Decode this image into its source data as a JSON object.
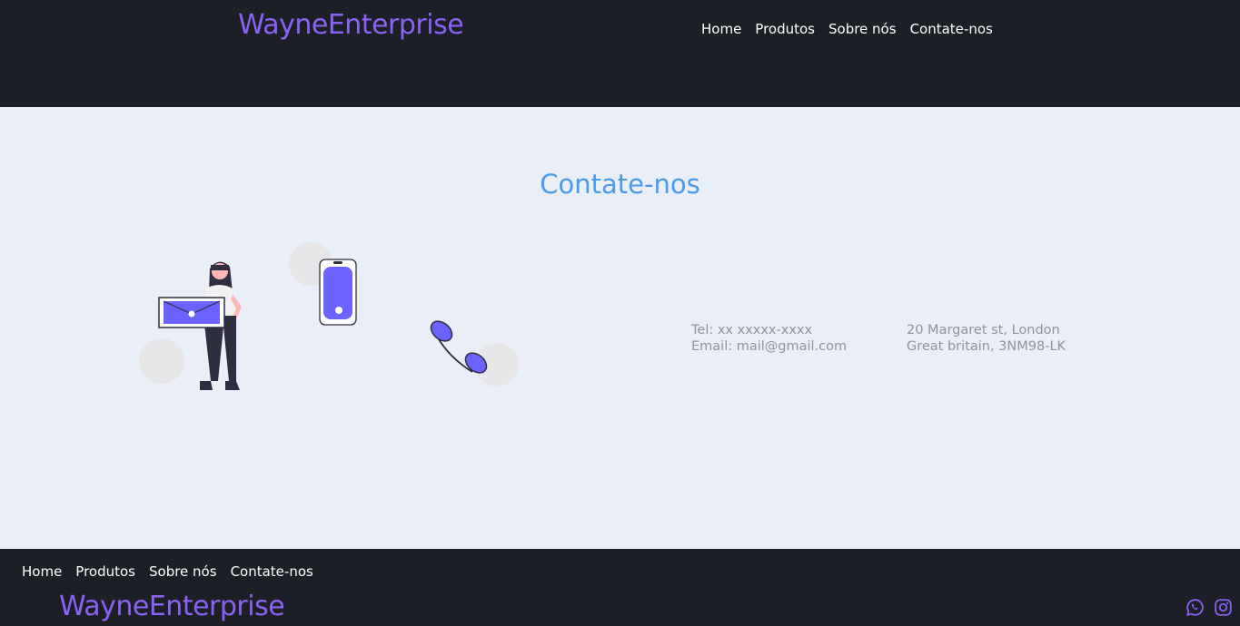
{
  "header": {
    "brand": "WayneEnterprise",
    "nav": [
      "Home",
      "Produtos",
      "Sobre nós",
      "Contate-nos"
    ]
  },
  "main": {
    "title": "Contate-nos",
    "contact": {
      "phone": "Tel: xx xxxxx-xxxx",
      "email": "Email: mail@gmail.com",
      "address_line1": "20 Margaret st, London",
      "address_line2": "Great britain, 3NM98-LK"
    }
  },
  "footer": {
    "nav": [
      "Home",
      "Produtos",
      "Sobre nós",
      "Contate-nos"
    ],
    "brand": "WayneEnterprise",
    "social_icons": [
      "whatsapp-icon",
      "instagram-icon"
    ]
  },
  "colors": {
    "brand": "#8a63f4",
    "accent": "#4a9bea",
    "dark_bg": "#1d1f27",
    "light_bg": "#e9eef7",
    "illustration": "#6c63ff"
  }
}
